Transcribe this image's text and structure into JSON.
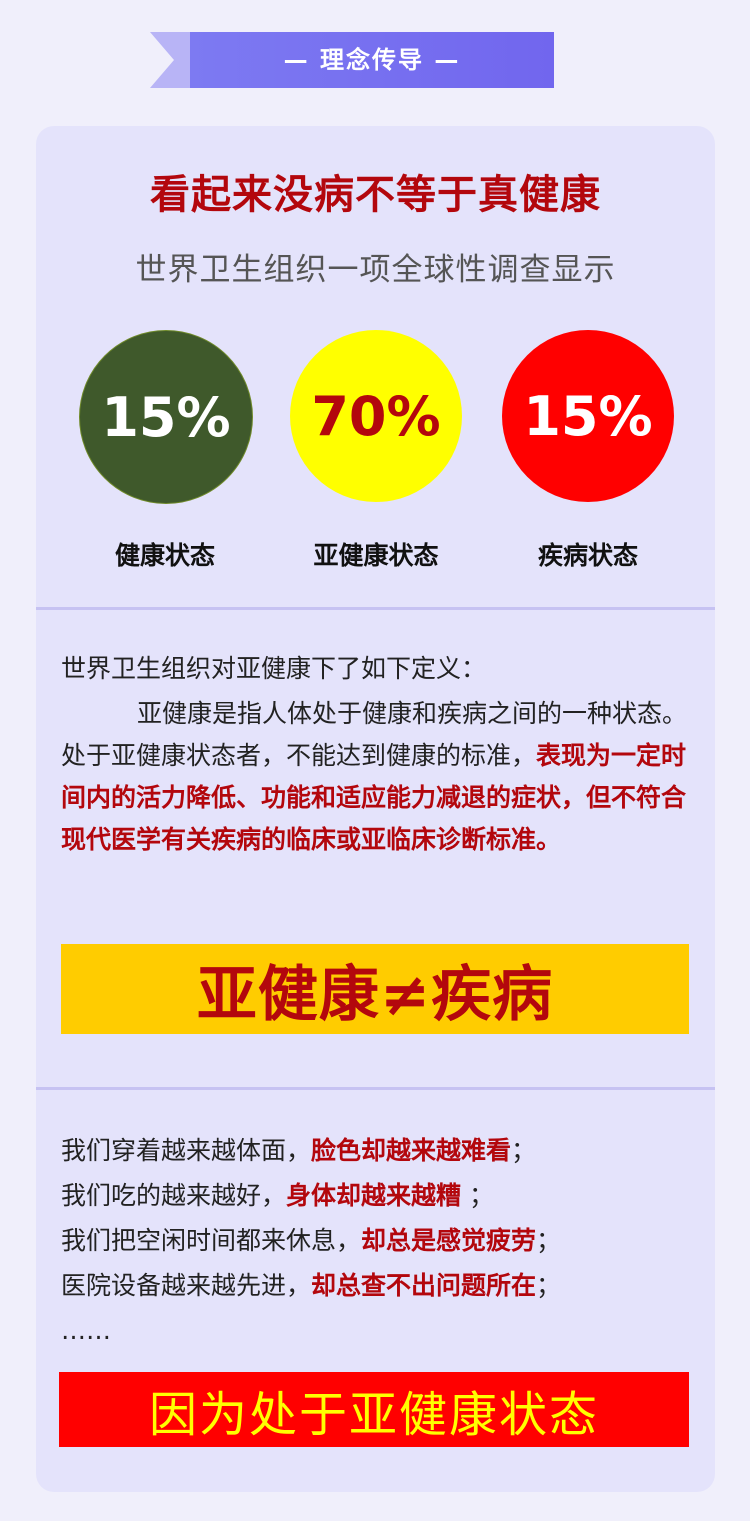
{
  "banner": {
    "title": "— 理念传导 —"
  },
  "headline": "看起来没病不等于真健康",
  "subhead": "世界卫生组织一项全球性调查显示",
  "stats": [
    {
      "value": "15%",
      "label": "健康状态",
      "color": "#3f592b"
    },
    {
      "value": "70%",
      "label": "亚健康状态",
      "color": "#ffff00"
    },
    {
      "value": "15%",
      "label": "疾病状态",
      "color": "#ff0000"
    }
  ],
  "definition": {
    "intro": "世界卫生组织对亚健康下了如下定义：",
    "body_normal": "亚健康是指人体处于健康和疾病之间的一种状态。处于亚健康状态者，不能达到健康的标准，",
    "body_highlight": "表现为一定时间内的活力降低、功能和适应能力减退的症状，但不符合现代医学有关疾病的临床或亚临床诊断标准。"
  },
  "equation_box": "亚健康≠疾病",
  "lines": [
    {
      "normal": "我们穿着越来越体面，",
      "highlight": "脸色却越来越难看",
      "tail": "；"
    },
    {
      "normal": "我们吃的越来越好，",
      "highlight": "身体却越来越糟",
      "tail": " ；"
    },
    {
      "normal": "我们把空闲时间都来休息，",
      "highlight": "却总是感觉疲劳",
      "tail": "；"
    },
    {
      "normal": "医院设备越来越先进，",
      "highlight": "却总查不出问题所在",
      "tail": "；"
    }
  ],
  "ellipsis": "……",
  "conclusion": "因为处于亚健康状态"
}
